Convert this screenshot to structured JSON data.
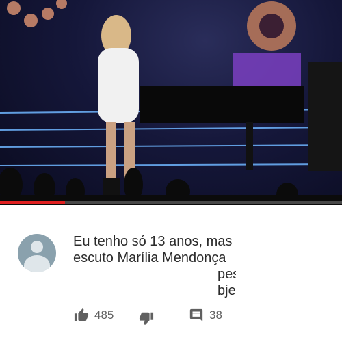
{
  "video": {
    "progress_fraction": 0.19
  },
  "comment": {
    "lines": [
      "Eu tenho só 13 anos, mas",
      "escuto Marília Mendonça",
      "pes",
      "bjei"
    ],
    "likes": "485",
    "replies": "38"
  },
  "icons": {
    "avatar": "default-avatar-icon",
    "like": "thumbs-up-icon",
    "dislike": "thumbs-down-icon",
    "reply": "comment-icon"
  },
  "colors": {
    "progress": "#e02020",
    "avatar_bg": "#8aa1ad",
    "icon": "#606060",
    "text": "#2b2b2b"
  }
}
